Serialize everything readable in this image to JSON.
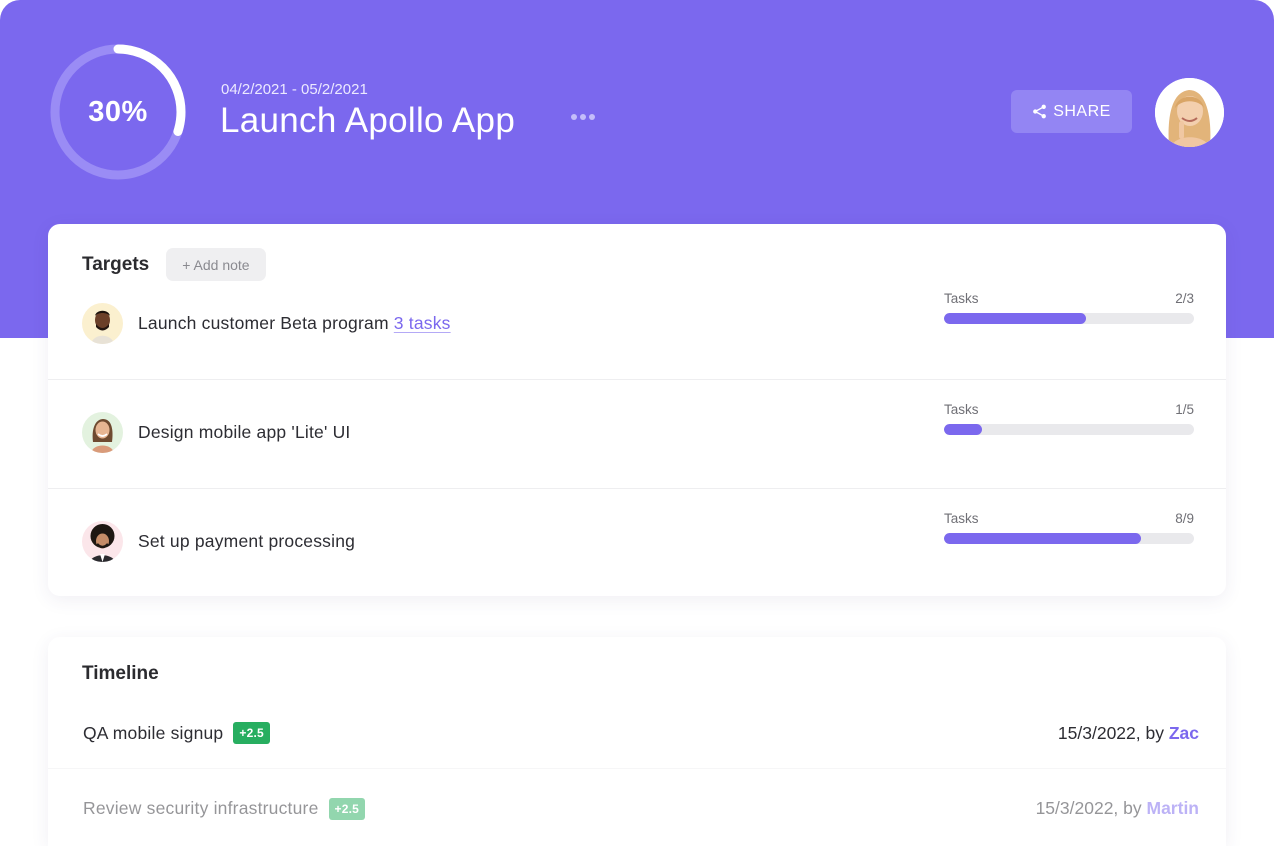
{
  "header": {
    "progress_percent": 30,
    "progress_label": "30%",
    "date_range": "04/2/2021 - 05/2/2021",
    "title": "Launch Apollo App",
    "more_icon": "more-horizontal-icon",
    "share_label": "SHARE",
    "share_icon": "share-icon",
    "avatar": "user-avatar",
    "accent_color": "#7B68EE"
  },
  "targets": {
    "title": "Targets",
    "add_note_label": "+ Add note",
    "rows": [
      {
        "label": "Launch customer Beta program",
        "link": "3 tasks",
        "progress_label": "Tasks",
        "count": "2/3",
        "done": 2,
        "total": 3
      },
      {
        "label": "Design mobile app 'Lite' UI",
        "link": "",
        "progress_label": "Tasks",
        "count": "1/5",
        "done": 1,
        "total": 5
      },
      {
        "label": "Set up payment processing",
        "link": "",
        "progress_label": "Tasks",
        "count": "8/9",
        "done": 8,
        "total": 9
      }
    ]
  },
  "timeline": {
    "title": "Timeline",
    "rows": [
      {
        "label": "QA mobile signup",
        "badge": "+2.5",
        "date": "15/3/2022, by ",
        "user": "Zac"
      },
      {
        "label": "Review security infrastructure",
        "badge": "+2.5",
        "date": "15/3/2022, by ",
        "user": "Martin"
      }
    ],
    "badge_color": "#27ae60"
  }
}
